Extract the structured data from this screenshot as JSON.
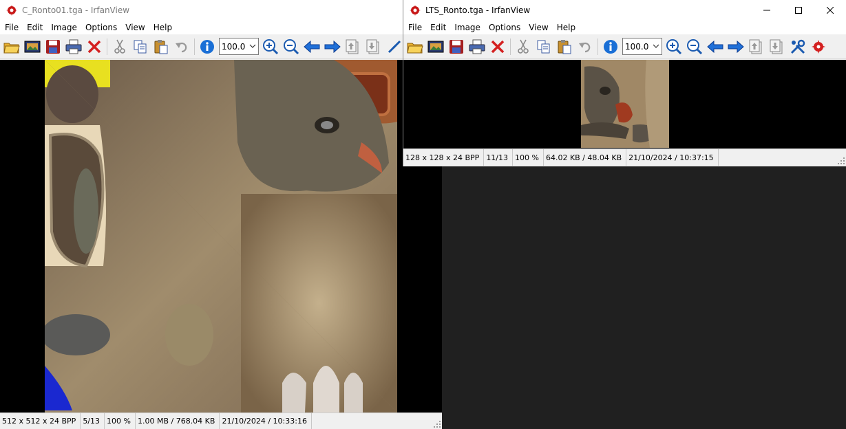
{
  "windows": {
    "left": {
      "title": "C_Ronto01.tga - IrfanView",
      "menu": [
        "File",
        "Edit",
        "Image",
        "Options",
        "View",
        "Help"
      ],
      "zoom": "100.0",
      "status": {
        "dimensions": "512 x 512 x 24 BPP",
        "index": "5/13",
        "zoom": "100 %",
        "size": "1.00 MB / 768.04 KB",
        "datetime": "21/10/2024 / 10:33:16"
      }
    },
    "right": {
      "title": "LTS_Ronto.tga - IrfanView",
      "menu": [
        "File",
        "Edit",
        "Image",
        "Options",
        "View",
        "Help"
      ],
      "zoom": "100.0",
      "status": {
        "dimensions": "128 x 128 x 24 BPP",
        "index": "11/13",
        "zoom": "100 %",
        "size": "64.02 KB / 48.04 KB",
        "datetime": "21/10/2024 / 10:37:15"
      }
    }
  },
  "icons": [
    "open-folder-icon",
    "thumbnails-icon",
    "save-icon",
    "print-icon",
    "delete-icon",
    "cut-icon",
    "copy-icon",
    "paste-icon",
    "undo-icon",
    "info-icon",
    "zoom-in-icon",
    "zoom-out-icon",
    "previous-icon",
    "next-icon",
    "page-up-icon",
    "page-down-icon",
    "settings-icon",
    "irfanview-icon"
  ],
  "colors": {
    "accent_blue": "#1a6fd6",
    "delete_red": "#d42020",
    "viewport": "#000000",
    "desktop": "#202020"
  }
}
